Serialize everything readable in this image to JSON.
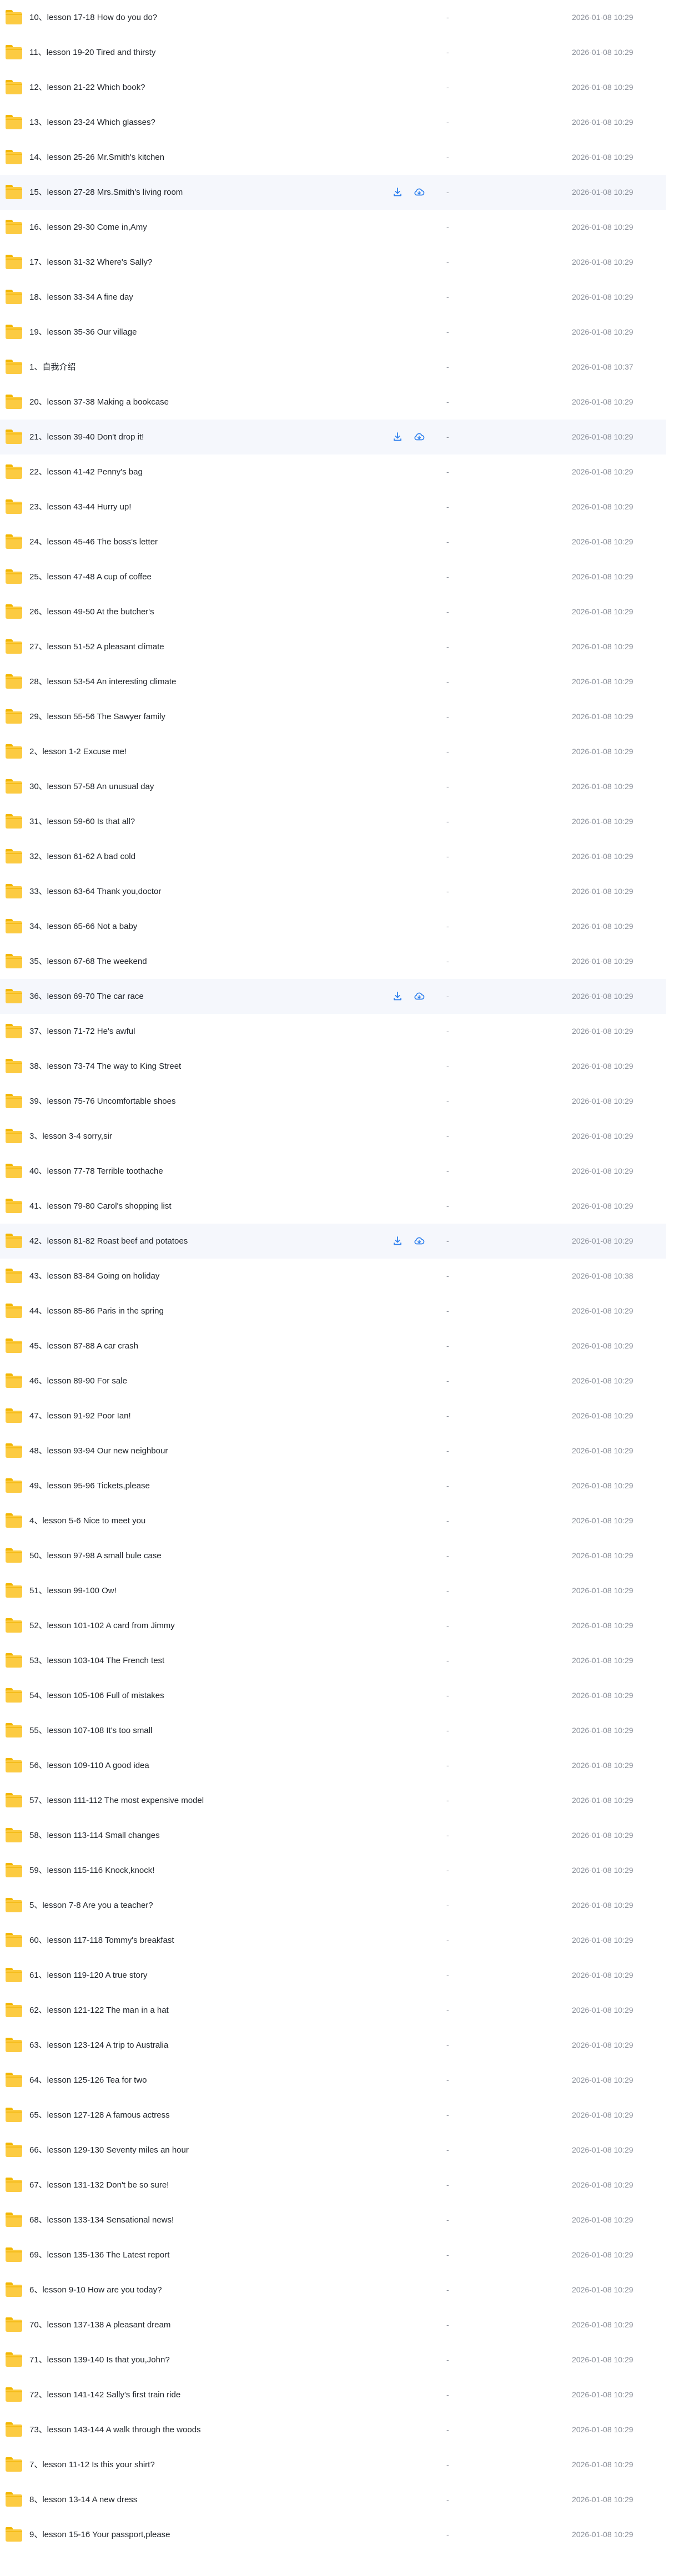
{
  "size_placeholder": "-",
  "hovered_rows": [
    5,
    12,
    28,
    35
  ],
  "rows": [
    {
      "name": "10、lesson 17-18 How do you do?",
      "date": "2026-01-08 10:29"
    },
    {
      "name": "11、lesson 19-20 Tired and thirsty",
      "date": "2026-01-08 10:29"
    },
    {
      "name": "12、lesson 21-22 Which book?",
      "date": "2026-01-08 10:29"
    },
    {
      "name": "13、lesson 23-24 Which glasses?",
      "date": "2026-01-08 10:29"
    },
    {
      "name": "14、lesson 25-26 Mr.Smith's kitchen",
      "date": "2026-01-08 10:29"
    },
    {
      "name": "15、lesson 27-28 Mrs.Smith's living room",
      "date": "2026-01-08 10:29"
    },
    {
      "name": "16、lesson 29-30 Come in,Amy",
      "date": "2026-01-08 10:29"
    },
    {
      "name": "17、lesson 31-32 Where's Sally?",
      "date": "2026-01-08 10:29"
    },
    {
      "name": "18、lesson 33-34 A fine day",
      "date": "2026-01-08 10:29"
    },
    {
      "name": "19、lesson 35-36 Our village",
      "date": "2026-01-08 10:29"
    },
    {
      "name": "1、自我介绍",
      "date": "2026-01-08 10:37"
    },
    {
      "name": "20、lesson 37-38 Making a bookcase",
      "date": "2026-01-08 10:29"
    },
    {
      "name": "21、lesson 39-40 Don't drop it!",
      "date": "2026-01-08 10:29"
    },
    {
      "name": "22、lesson 41-42 Penny's bag",
      "date": "2026-01-08 10:29"
    },
    {
      "name": "23、lesson 43-44 Hurry up!",
      "date": "2026-01-08 10:29"
    },
    {
      "name": "24、lesson 45-46 The boss's letter",
      "date": "2026-01-08 10:29"
    },
    {
      "name": "25、lesson 47-48 A cup of coffee",
      "date": "2026-01-08 10:29"
    },
    {
      "name": "26、lesson 49-50 At the butcher's",
      "date": "2026-01-08 10:29"
    },
    {
      "name": "27、lesson 51-52 A pleasant climate",
      "date": "2026-01-08 10:29"
    },
    {
      "name": "28、lesson 53-54 An interesting climate",
      "date": "2026-01-08 10:29"
    },
    {
      "name": "29、lesson 55-56 The Sawyer family",
      "date": "2026-01-08 10:29"
    },
    {
      "name": "2、lesson 1-2 Excuse me!",
      "date": "2026-01-08 10:29"
    },
    {
      "name": "30、lesson 57-58 An unusual day",
      "date": "2026-01-08 10:29"
    },
    {
      "name": "31、lesson 59-60 Is that all?",
      "date": "2026-01-08 10:29"
    },
    {
      "name": "32、lesson 61-62 A bad cold",
      "date": "2026-01-08 10:29"
    },
    {
      "name": "33、lesson 63-64 Thank you,doctor",
      "date": "2026-01-08 10:29"
    },
    {
      "name": "34、lesson 65-66 Not a baby",
      "date": "2026-01-08 10:29"
    },
    {
      "name": "35、lesson 67-68 The weekend",
      "date": "2026-01-08 10:29"
    },
    {
      "name": "36、lesson 69-70 The car race",
      "date": "2026-01-08 10:29"
    },
    {
      "name": "37、lesson 71-72 He's awful",
      "date": "2026-01-08 10:29"
    },
    {
      "name": "38、lesson 73-74 The way to King Street",
      "date": "2026-01-08 10:29"
    },
    {
      "name": "39、lesson 75-76 Uncomfortable shoes",
      "date": "2026-01-08 10:29"
    },
    {
      "name": "3、lesson 3-4 sorry,sir",
      "date": "2026-01-08 10:29"
    },
    {
      "name": "40、lesson 77-78 Terrible toothache",
      "date": "2026-01-08 10:29"
    },
    {
      "name": "41、lesson 79-80 Carol's shopping list",
      "date": "2026-01-08 10:29"
    },
    {
      "name": "42、lesson 81-82 Roast beef and potatoes",
      "date": "2026-01-08 10:29"
    },
    {
      "name": "43、lesson 83-84 Going on holiday",
      "date": "2026-01-08 10:38"
    },
    {
      "name": "44、lesson 85-86 Paris in the spring",
      "date": "2026-01-08 10:29"
    },
    {
      "name": "45、lesson 87-88 A car crash",
      "date": "2026-01-08 10:29"
    },
    {
      "name": "46、lesson 89-90 For sale",
      "date": "2026-01-08 10:29"
    },
    {
      "name": "47、lesson 91-92 Poor Ian!",
      "date": "2026-01-08 10:29"
    },
    {
      "name": "48、lesson 93-94 Our new neighbour",
      "date": "2026-01-08 10:29"
    },
    {
      "name": "49、lesson 95-96 Tickets,please",
      "date": "2026-01-08 10:29"
    },
    {
      "name": "4、lesson 5-6 Nice to meet you",
      "date": "2026-01-08 10:29"
    },
    {
      "name": "50、lesson 97-98 A small bule case",
      "date": "2026-01-08 10:29"
    },
    {
      "name": "51、lesson 99-100 Ow!",
      "date": "2026-01-08 10:29"
    },
    {
      "name": "52、lesson 101-102 A card from Jimmy",
      "date": "2026-01-08 10:29"
    },
    {
      "name": "53、lesson 103-104 The French test",
      "date": "2026-01-08 10:29"
    },
    {
      "name": "54、lesson 105-106 Full of mistakes",
      "date": "2026-01-08 10:29"
    },
    {
      "name": "55、lesson 107-108 It's too small",
      "date": "2026-01-08 10:29"
    },
    {
      "name": "56、lesson 109-110 A good idea",
      "date": "2026-01-08 10:29"
    },
    {
      "name": "57、lesson 111-112 The most expensive model",
      "date": "2026-01-08 10:29"
    },
    {
      "name": "58、lesson 113-114 Small changes",
      "date": "2026-01-08 10:29"
    },
    {
      "name": "59、lesson 115-116 Knock,knock!",
      "date": "2026-01-08 10:29"
    },
    {
      "name": "5、lesson 7-8 Are you a teacher?",
      "date": "2026-01-08 10:29"
    },
    {
      "name": "60、lesson 117-118 Tommy's breakfast",
      "date": "2026-01-08 10:29"
    },
    {
      "name": "61、lesson 119-120 A true story",
      "date": "2026-01-08 10:29"
    },
    {
      "name": "62、lesson 121-122 The man in a hat",
      "date": "2026-01-08 10:29"
    },
    {
      "name": "63、lesson 123-124 A trip to Australia",
      "date": "2026-01-08 10:29"
    },
    {
      "name": "64、lesson 125-126 Tea for two",
      "date": "2026-01-08 10:29"
    },
    {
      "name": "65、lesson 127-128 A famous actress",
      "date": "2026-01-08 10:29"
    },
    {
      "name": "66、lesson 129-130 Seventy miles an hour",
      "date": "2026-01-08 10:29"
    },
    {
      "name": "67、lesson 131-132 Don't be so sure!",
      "date": "2026-01-08 10:29"
    },
    {
      "name": "68、lesson 133-134 Sensational news!",
      "date": "2026-01-08 10:29"
    },
    {
      "name": "69、lesson 135-136 The Latest report",
      "date": "2026-01-08 10:29"
    },
    {
      "name": "6、lesson 9-10 How are you today?",
      "date": "2026-01-08 10:29"
    },
    {
      "name": "70、lesson 137-138 A pleasant dream",
      "date": "2026-01-08 10:29"
    },
    {
      "name": "71、lesson 139-140 Is that you,John?",
      "date": "2026-01-08 10:29"
    },
    {
      "name": "72、lesson 141-142 Sally's first train ride",
      "date": "2026-01-08 10:29"
    },
    {
      "name": "73、lesson 143-144 A walk through the woods",
      "date": "2026-01-08 10:29"
    },
    {
      "name": "7、lesson 11-12 Is this your shirt?",
      "date": "2026-01-08 10:29"
    },
    {
      "name": "8、lesson 13-14 A new dress",
      "date": "2026-01-08 10:29"
    },
    {
      "name": "9、lesson 15-16 Your passport,please",
      "date": "2026-01-08 10:29"
    }
  ]
}
